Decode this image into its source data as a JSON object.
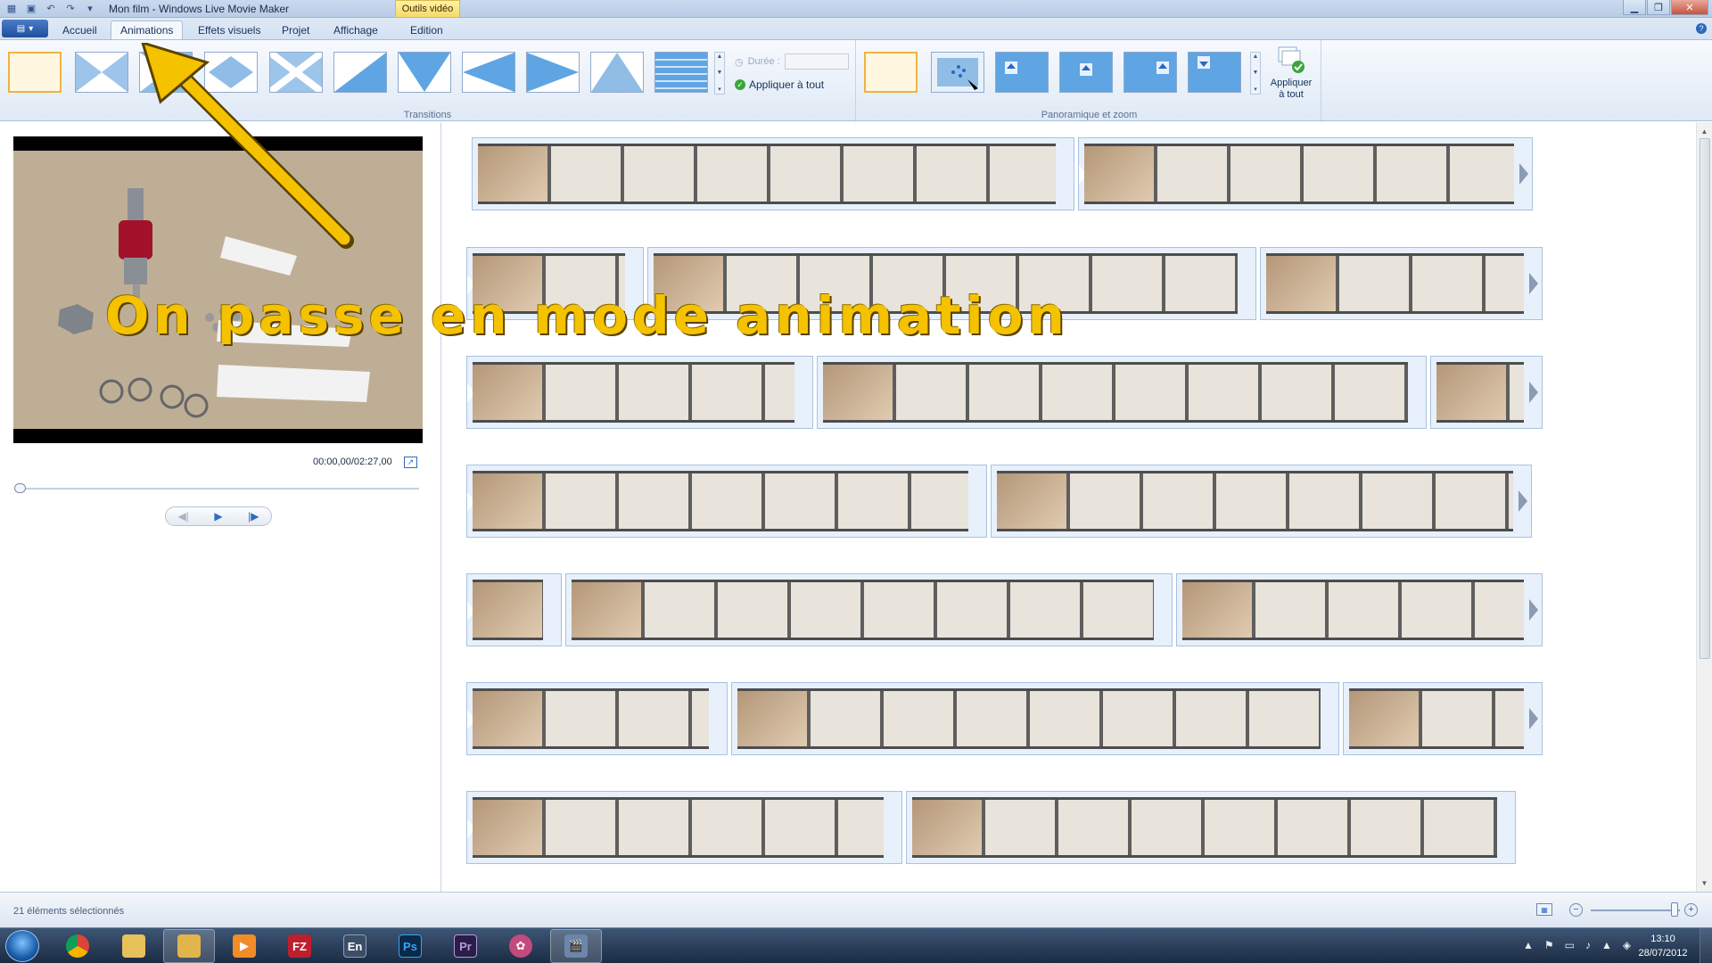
{
  "window": {
    "title": "Mon film - Windows Live Movie Maker",
    "context_tab": "Outils vidéo"
  },
  "tabs": [
    {
      "label": "Accueil"
    },
    {
      "label": "Animations"
    },
    {
      "label": "Effets visuels"
    },
    {
      "label": "Projet"
    },
    {
      "label": "Affichage"
    },
    {
      "label": "Edition"
    }
  ],
  "ribbon": {
    "transitions": {
      "group_label": "Transitions",
      "duration_label": "Durée :",
      "duration_value": "",
      "apply_all": "Appliquer à tout"
    },
    "pan_zoom": {
      "group_label": "Panoramique et zoom",
      "apply_all_line1": "Appliquer",
      "apply_all_line2": "à tout"
    }
  },
  "preview": {
    "time": "00:00,00/02:27,00",
    "progress": 0
  },
  "overlay": {
    "caption": "On passe en mode animation",
    "accent": "#f5c200"
  },
  "statusbar": {
    "text": "21 éléments sélectionnés",
    "zoom_level": 0.9
  },
  "taskbar": {
    "apps": [
      {
        "name": "chrome",
        "label": ""
      },
      {
        "name": "explorer-folder",
        "label": ""
      },
      {
        "name": "explorer-files",
        "label": ""
      },
      {
        "name": "media-player",
        "label": ""
      },
      {
        "name": "filezilla",
        "label": "FZ"
      },
      {
        "name": "language",
        "label": "En"
      },
      {
        "name": "photoshop",
        "label": "Ps"
      },
      {
        "name": "premiere",
        "label": "Pr"
      },
      {
        "name": "paint-tool",
        "label": ""
      },
      {
        "name": "movie-maker",
        "label": ""
      }
    ],
    "clock_time": "13:10",
    "clock_date": "28/07/2012"
  },
  "colors": {
    "ribbon_bg": "#dfe9f5",
    "selection": "#f0b440",
    "caption": "#f5c200"
  }
}
